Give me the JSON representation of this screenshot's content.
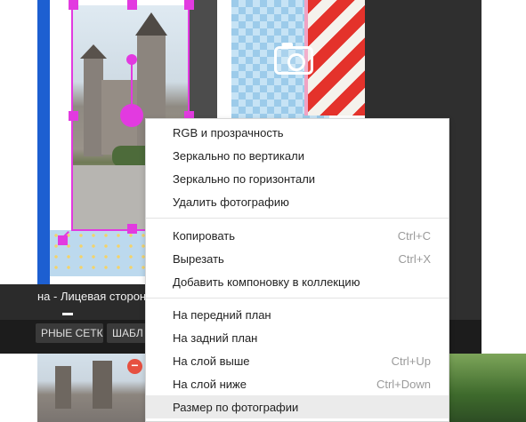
{
  "canvas": {
    "strip_caption": "на - Лицевая сторона",
    "toolbar_buttons": [
      "РНЫЕ СЕТКИ",
      "ШАБЛ"
    ]
  },
  "context_menu": {
    "groups": [
      [
        {
          "label": "RGB и прозрачность",
          "shortcut": ""
        },
        {
          "label": "Зеркально по вертикали",
          "shortcut": ""
        },
        {
          "label": "Зеркально по горизонтали",
          "shortcut": ""
        },
        {
          "label": "Удалить фотографию",
          "shortcut": ""
        }
      ],
      [
        {
          "label": "Копировать",
          "shortcut": "Ctrl+C"
        },
        {
          "label": "Вырезать",
          "shortcut": "Ctrl+X"
        },
        {
          "label": "Добавить компоновку в коллекцию",
          "shortcut": ""
        }
      ],
      [
        {
          "label": "На передний план",
          "shortcut": ""
        },
        {
          "label": "На задний план",
          "shortcut": ""
        },
        {
          "label": "На слой выше",
          "shortcut": "Ctrl+Up"
        },
        {
          "label": "На слой ниже",
          "shortcut": "Ctrl+Down"
        },
        {
          "label": "Размер по фотографии",
          "shortcut": "",
          "highlighted": true
        }
      ]
    ]
  },
  "icons": {
    "camera": "camera-icon",
    "remove": "remove-icon"
  },
  "colors": {
    "selection": "#e23ae0",
    "menu_highlight": "#ebebeb",
    "shortcut_text": "#9a9a9a"
  }
}
